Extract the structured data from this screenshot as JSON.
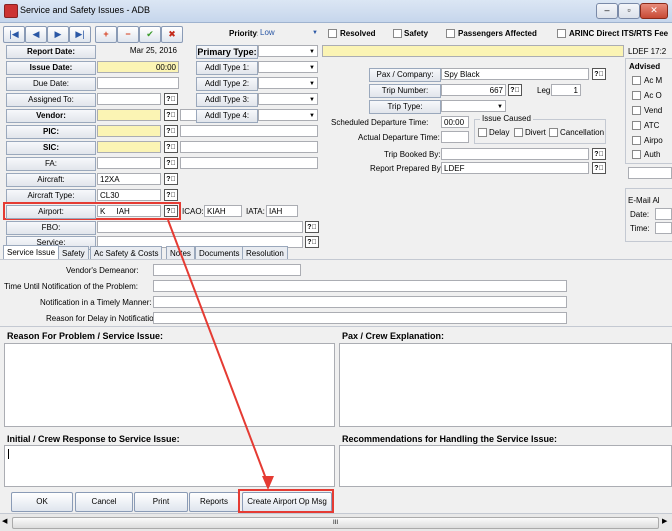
{
  "window": {
    "title": "Service and Safety Issues - ADB"
  },
  "nav": {
    "first": "|◀",
    "prev": "◀",
    "next": "▶",
    "last": "▶|",
    "add": "+",
    "remove": "−",
    "save": "✔",
    "cancel": "✖"
  },
  "priority": {
    "label": "Priority:",
    "value": "Low"
  },
  "flags": {
    "resolved": "Resolved",
    "safety": "Safety",
    "passengers": "Passengers Affected",
    "arinc": "ARINC Direct ITS/RTS Fee"
  },
  "left": {
    "report_date_label": "Report Date:",
    "report_date": "Mar 25, 2016",
    "issue_date_label": "Issue Date:",
    "issue_date": "00:00",
    "due_date_label": "Due Date:",
    "assigned_label": "Assigned To:",
    "vendor_label": "Vendor:",
    "pic_label": "PIC:",
    "sic_label": "SIC:",
    "fa_label": "FA:",
    "aircraft_label": "Aircraft:",
    "aircraft": "12XA",
    "aircraft_type_label": "Aircraft Type:",
    "aircraft_type": "CL30",
    "airport_label": "Airport:",
    "airport_k": "K",
    "airport_iah": "IAH",
    "icao_label": "ICAO:",
    "icao": "KIAH",
    "iata_label": "IATA:",
    "iata": "IAH",
    "fbo_label": "FBO:",
    "service_label": "Service:",
    "q": "?⃞"
  },
  "types": {
    "primary": "Primary Type:",
    "a1": "Addl Type 1:",
    "a2": "Addl Type 2:",
    "a3": "Addl Type 3:",
    "a4": "Addl Type 4:"
  },
  "mid": {
    "pax_label": "Pax / Company:",
    "pax": "Spy Black",
    "trip_label": "Trip Number:",
    "trip": "667",
    "leg_label": "Leg:",
    "leg": "1",
    "trip_type_label": "Trip Type:",
    "sched_label": "Scheduled Departure Time:",
    "sched": "00:00",
    "actual_label": "Actual Departure Time:",
    "issue_caused": "Issue Caused",
    "delay": "Delay",
    "divert": "Divert",
    "cancellation": "Cancellation",
    "booked_label": "Trip Booked By:",
    "prepared_label": "Report Prepared By:",
    "prepared": "LDEF"
  },
  "right": {
    "user": "LDEF 17:2",
    "advised": "Advised",
    "items": [
      "Ac M",
      "Ac O",
      "Vend",
      "ATC",
      "Airpo",
      "Auth"
    ],
    "email": "E-Mail Al",
    "date": "Date:",
    "time": "Time:"
  },
  "tabs": [
    "Service Issue",
    "Safety",
    "Ac Safety & Costs",
    "Notes",
    "Documents",
    "Resolution"
  ],
  "service": {
    "demeanor": "Vendor's Demeanor:",
    "time_until": "Time Until Notification of the Problem:",
    "timely": "Notification in a Timely Manner:",
    "reason_delay": "Reason for Delay in Notification:",
    "reason": "Reason For Problem / Service Issue:",
    "pax_exp": "Pax / Crew Explanation:",
    "initial": "Initial / Crew Response to Service Issue:",
    "recommend": "Recommendations for Handling the Service Issue:"
  },
  "buttons": {
    "ok": "OK",
    "cancel": "Cancel",
    "print": "Print",
    "reports": "Reports",
    "create": "Create Airport Op Msg"
  },
  "scrollbar": {
    "mark": "III"
  }
}
